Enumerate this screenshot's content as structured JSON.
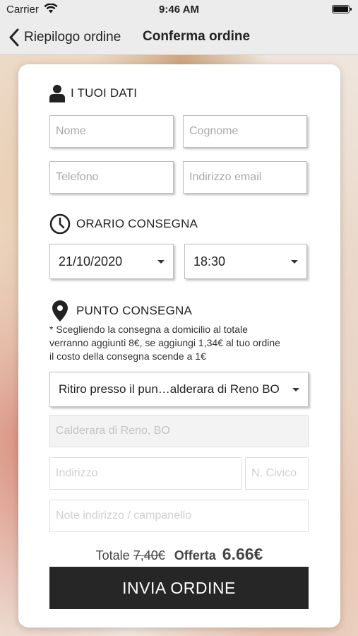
{
  "status_bar": {
    "carrier": "Carrier",
    "time": "9:46 AM"
  },
  "nav": {
    "back_label": "Riepilogo ordine",
    "title": "Conferma ordine"
  },
  "section_personal": {
    "heading": "I TUOI DATI",
    "name_placeholder": "Nome",
    "surname_placeholder": "Cognome",
    "phone_placeholder": "Telefono",
    "email_placeholder": "Indirizzo email"
  },
  "section_delivery_time": {
    "heading": "ORARIO CONSEGNA",
    "date": "21/10/2020",
    "time": "18:30"
  },
  "section_delivery_point": {
    "heading": "PUNTO CONSEGNA",
    "note_line1": "* Scegliendo la consegna a domicilio al totale",
    "note_line2": "verranno aggiunti 8€, se aggiungi 1,34€ al tuo ordine",
    "note_line3": "il costo della consegna scende a 1€",
    "pickup_selected": "Ritiro presso il pun…alderara di Reno BO",
    "city_placeholder": "Calderara di Reno, BO",
    "address_placeholder": "Indirizzo",
    "civic_placeholder": "N. Civico",
    "address_notes_placeholder": "Note indirizzo / campanello"
  },
  "totals": {
    "label": "Totale",
    "old_price": "7,40€",
    "offer_label": "Offerta",
    "offer_price": "6.66€"
  },
  "submit_label": "INVIA ORDINE",
  "colors": {
    "button_bg": "#262626",
    "bar_bg": "#ececec"
  }
}
